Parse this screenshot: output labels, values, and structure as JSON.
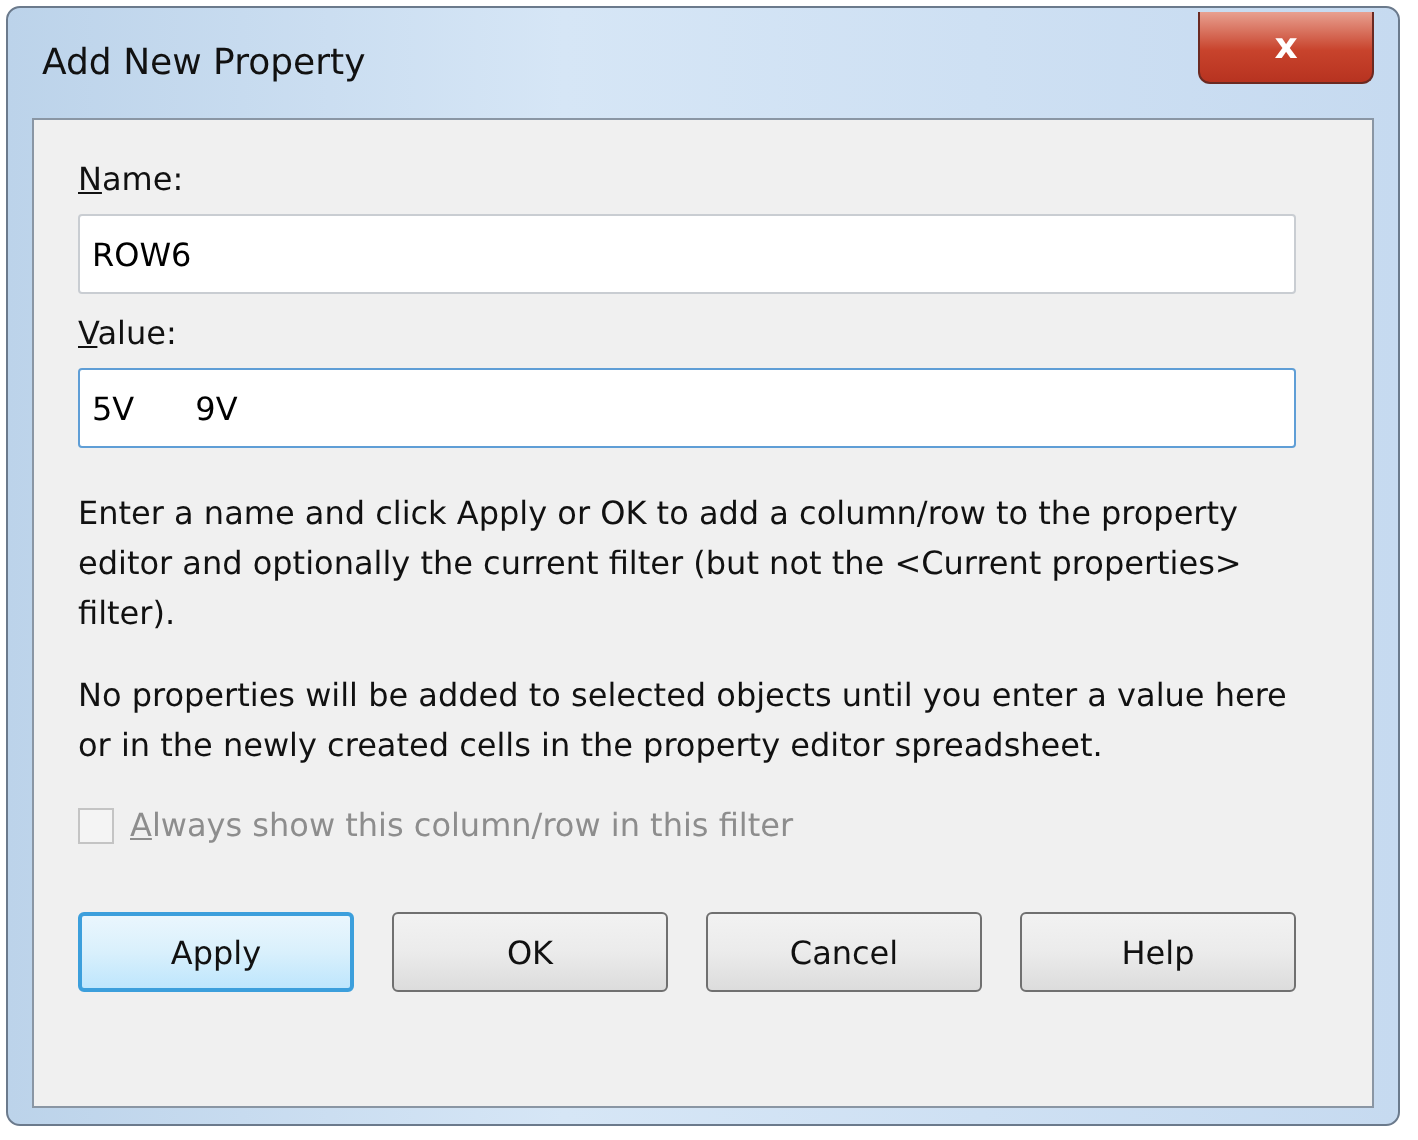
{
  "window": {
    "title": "Add New Property",
    "close": "x"
  },
  "fields": [
    {
      "label": "Name:",
      "value": "ROW6",
      "focused": false
    },
    {
      "label": "Value:",
      "value": "5V      9V",
      "focused": true
    }
  ],
  "paragraphs": [
    "Enter a name and click Apply or OK to add a column/row to the property editor and optionally the current filter (but not the <Current properties> filter).",
    "No properties will be added to selected objects until you enter a value here or in the newly created cells in the property editor spreadsheet."
  ],
  "checkbox": {
    "label": "Always show this column/row in this filter",
    "checked": false,
    "disabled": true
  },
  "buttons": [
    {
      "label": "Apply",
      "default": true
    },
    {
      "label": "OK",
      "default": false
    },
    {
      "label": "Cancel",
      "default": false
    },
    {
      "label": "Help",
      "default": false
    }
  ]
}
